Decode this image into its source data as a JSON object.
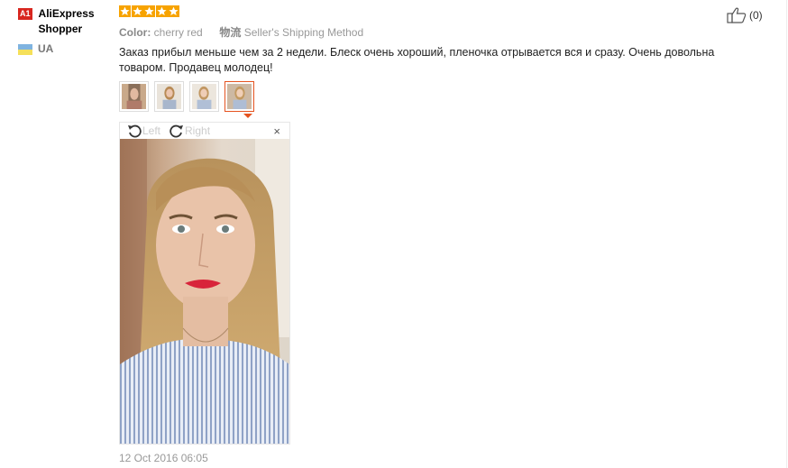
{
  "user": {
    "badge": "A1",
    "name": "AliExpress Shopper",
    "country": "UA"
  },
  "rating": {
    "stars": 5,
    "max": 5
  },
  "meta": {
    "color_label": "Color:",
    "color_value": "cherry red",
    "shipping_label": "物流",
    "shipping_value": "Seller's Shipping Method"
  },
  "comment": "Заказ прибыл меньше чем за 2 недели. Блеск очень хороший, пленочка отрывается вся и сразу. Очень довольна товаром. Продавец молодец!",
  "viewer": {
    "left_label": "Left",
    "right_label": "Right",
    "close": "×",
    "active_index": 3
  },
  "like": {
    "count": "(0)"
  },
  "date": "12 Oct 2016 06:05",
  "colors": {
    "accent": "#e5531f",
    "star": "#f7a300",
    "badge": "#d8261f"
  }
}
